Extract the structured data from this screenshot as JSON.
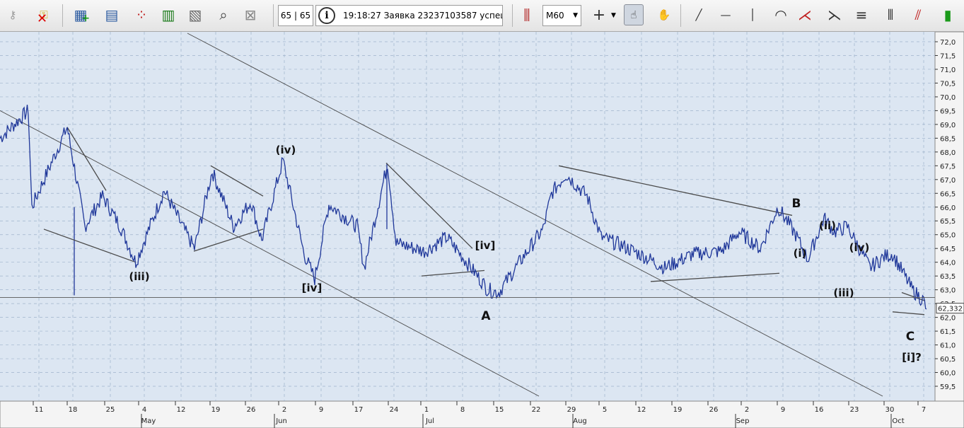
{
  "toolbar": {
    "counter_text": "65 | 65",
    "status_time": "19:18:27",
    "status_message": "Заявка 23237103587 успеш",
    "timeframe": "M60",
    "buttons": [
      {
        "name": "key-icon",
        "glyph": "⚷"
      },
      {
        "name": "keys-disconnect-icon",
        "glyph": "⚿"
      },
      {
        "name": "new-table-icon",
        "glyph": "▦"
      },
      {
        "name": "chart-window-icon",
        "glyph": "▤"
      },
      {
        "name": "scatter-window-icon",
        "glyph": "⁘"
      },
      {
        "name": "quotes-window-icon",
        "glyph": "▥"
      },
      {
        "name": "deals-window-icon",
        "glyph": "▧"
      },
      {
        "name": "search-table-icon",
        "glyph": "⌕"
      },
      {
        "name": "delete-table-icon",
        "glyph": "⊠"
      }
    ],
    "tools": [
      {
        "name": "indicators-icon",
        "glyph": "⫼"
      },
      {
        "name": "crosshair-icon",
        "glyph": "+"
      },
      {
        "name": "pointer-hand-icon",
        "glyph": "☝"
      },
      {
        "name": "pan-hand-icon",
        "glyph": "✋"
      },
      {
        "name": "trend-line-icon",
        "glyph": "╱"
      },
      {
        "name": "horizontal-line-icon",
        "glyph": "—"
      },
      {
        "name": "vertical-line-icon",
        "glyph": "│"
      },
      {
        "name": "fibonacci-arcs-icon",
        "glyph": "◠"
      },
      {
        "name": "fibonacci-fan-icon",
        "glyph": "⋌"
      },
      {
        "name": "gann-fan-icon",
        "glyph": "⋋"
      },
      {
        "name": "fibonacci-levels-icon",
        "glyph": "≡"
      },
      {
        "name": "time-zones-icon",
        "glyph": "⦀"
      },
      {
        "name": "channel-icon",
        "glyph": "⫽"
      },
      {
        "name": "candles-icon",
        "glyph": "▮"
      }
    ]
  },
  "chart_data": {
    "type": "line",
    "series": [
      {
        "x": [
          "Apr 7",
          "Apr 11",
          "Apr 13",
          "Apr 18",
          "Apr 22",
          "Apr 25",
          "Apr 28",
          "May 4",
          "May 8",
          "May 12",
          "May 15",
          "May 19",
          "May 22",
          "May 26",
          "May 30",
          "Jun 2",
          "Jun 5",
          "Jun 9",
          "Jun 12",
          "Jun 17",
          "Jun 20",
          "Jun 24",
          "Jun 27",
          "Jul 1",
          "Jul 4",
          "Jul 8",
          "Jul 11",
          "Jul 15",
          "Jul 18",
          "Jul 22",
          "Jul 25",
          "Jul 29",
          "Aug 1",
          "Aug 5",
          "Aug 8",
          "Aug 12",
          "Aug 15",
          "Aug 19",
          "Aug 22",
          "Aug 26",
          "Aug 29",
          "Sep 2",
          "Sep 5",
          "Sep 9",
          "Sep 11",
          "Sep 14",
          "Sep 17",
          "Sep 20",
          "Sep 23",
          "Sep 26",
          "Sep 29",
          "Oct 2",
          "Oct 7"
        ],
        "values": [
          68.5,
          69.5,
          66.0,
          68.9,
          65.3,
          66.4,
          65.3,
          64.0,
          66.6,
          65.2,
          64.5,
          67.3,
          65.3,
          66.2,
          64.8,
          67.7,
          64.3,
          63.4,
          66.1,
          65.3,
          63.8,
          67.6,
          64.7,
          64.4,
          64.9,
          64.0,
          63.0,
          62.9,
          64.2,
          65.2,
          66.5,
          67.2,
          66.4,
          64.9,
          64.6,
          64.2,
          63.8,
          64.3,
          64.4,
          65.1,
          64.5,
          66.0,
          65.0,
          64.1,
          65.6,
          65.1,
          65.3,
          63.8,
          64.2,
          64.3,
          63.0,
          62.6,
          62.3
        ]
      }
    ],
    "y_range": [
      59.5,
      72.0
    ],
    "y_ticks": [
      "72,0",
      "71,5",
      "71,0",
      "70,5",
      "70,0",
      "69,5",
      "69,0",
      "68,5",
      "68,0",
      "67,5",
      "67,0",
      "66,5",
      "66,0",
      "65,5",
      "65,0",
      "64,5",
      "64,0",
      "63,5",
      "63,0",
      "62,5",
      "62,0",
      "61,5",
      "61,0",
      "60,5",
      "60,0",
      "59,5"
    ],
    "last_price_label": "62,332",
    "day_ticks": [
      "11",
      "18",
      "25",
      "4",
      "12",
      "19",
      "26",
      "2",
      "9",
      "17",
      "24",
      "1",
      "8",
      "15",
      "22",
      "29",
      "5",
      "12",
      "19",
      "26",
      "2",
      "9",
      "16",
      "23",
      "30",
      "7"
    ],
    "month_labels": [
      "May",
      "Jun",
      "Jul",
      "Aug",
      "Sep",
      "Oct"
    ],
    "annotations": [
      "(iii)",
      "(iv)",
      "[iv]",
      "[iv]",
      "A",
      "B",
      "(i)",
      "(ii)",
      "(iii)",
      "(iv)",
      "C",
      "[i]?"
    ],
    "grid": true,
    "colors": {
      "background": "#dce6f2",
      "price_line": "#20389a",
      "grid": "#9fb4cc",
      "trend": "#4a4a4a"
    }
  }
}
